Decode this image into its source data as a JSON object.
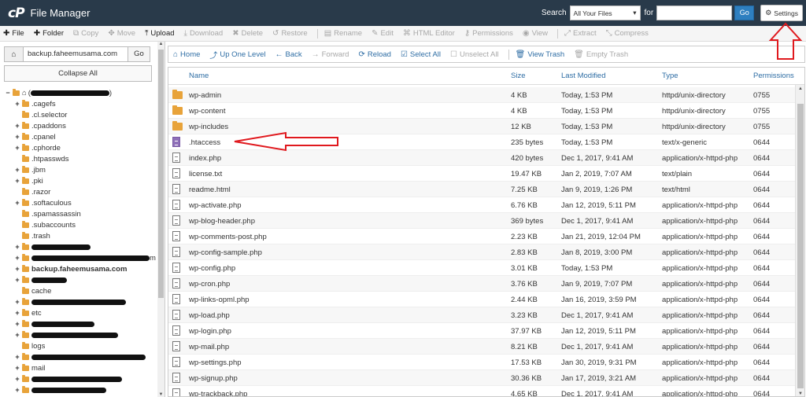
{
  "header": {
    "logo_mark": "cP",
    "title": "File Manager",
    "search_label": "Search",
    "search_scope": "All Your Files",
    "for_label": "for",
    "search_value": "",
    "go_label": "Go",
    "settings_label": "Settings"
  },
  "toolbar": {
    "items": [
      {
        "label": "File",
        "icon": "plus-icon",
        "enabled": true
      },
      {
        "label": "Folder",
        "icon": "plus-icon",
        "enabled": true
      },
      {
        "label": "Copy",
        "icon": "copy-icon",
        "enabled": false
      },
      {
        "label": "Move",
        "icon": "move-icon",
        "enabled": false
      },
      {
        "label": "Upload",
        "icon": "upload-icon",
        "enabled": true
      },
      {
        "label": "Download",
        "icon": "download-icon",
        "enabled": false
      },
      {
        "label": "Delete",
        "icon": "delete-icon",
        "enabled": false
      },
      {
        "label": "Restore",
        "icon": "restore-icon",
        "enabled": false
      },
      {
        "label": "Rename",
        "icon": "rename-icon",
        "enabled": false
      },
      {
        "label": "Edit",
        "icon": "pencil-icon",
        "enabled": false
      },
      {
        "label": "HTML Editor",
        "icon": "code-icon",
        "enabled": false
      },
      {
        "label": "Permissions",
        "icon": "key-icon",
        "enabled": false
      },
      {
        "label": "View",
        "icon": "eye-icon",
        "enabled": false
      },
      {
        "label": "Extract",
        "icon": "extract-icon",
        "enabled": false
      },
      {
        "label": "Compress",
        "icon": "compress-icon",
        "enabled": false
      }
    ]
  },
  "left": {
    "path_value": "backup.faheemusama.com",
    "go_label": "Go",
    "collapse_label": "Collapse All",
    "tree": [
      {
        "toggle": "−",
        "label": "(",
        "suffix": ")",
        "redact": 100,
        "home": true
      },
      {
        "toggle": "+",
        "label": ".cagefs"
      },
      {
        "toggle": "",
        "label": ".cl.selector"
      },
      {
        "toggle": "+",
        "label": ".cpaddons"
      },
      {
        "toggle": "+",
        "label": ".cpanel"
      },
      {
        "toggle": "+",
        "label": ".cphorde"
      },
      {
        "toggle": "",
        "label": ".htpasswds"
      },
      {
        "toggle": "+",
        "label": ".jbm"
      },
      {
        "toggle": "+",
        "label": ".pki"
      },
      {
        "toggle": "",
        "label": ".razor"
      },
      {
        "toggle": "+",
        "label": ".softaculous"
      },
      {
        "toggle": "",
        "label": ".spamassassin"
      },
      {
        "toggle": "",
        "label": ".subaccounts"
      },
      {
        "toggle": "",
        "label": ".trash"
      },
      {
        "toggle": "+",
        "label": "",
        "redact": 75
      },
      {
        "toggle": "+",
        "label": "",
        "redact": 150,
        "suffix": "m"
      },
      {
        "toggle": "+",
        "label": "backup.faheemusama.com",
        "bold": true
      },
      {
        "toggle": "+",
        "label": "",
        "redact": 45
      },
      {
        "toggle": "",
        "label": "cache"
      },
      {
        "toggle": "+",
        "label": "",
        "redact": 120
      },
      {
        "toggle": "+",
        "label": "etc"
      },
      {
        "toggle": "+",
        "label": "",
        "redact": 80
      },
      {
        "toggle": "+",
        "label": "",
        "redact": 110
      },
      {
        "toggle": "",
        "label": "logs"
      },
      {
        "toggle": "+",
        "label": "",
        "redact": 145
      },
      {
        "toggle": "+",
        "label": "mail"
      },
      {
        "toggle": "+",
        "label": "",
        "redact": 115
      },
      {
        "toggle": "+",
        "label": "",
        "redact": 95
      }
    ]
  },
  "nav": {
    "items": [
      {
        "label": "Home",
        "icon": "home-icon",
        "enabled": true
      },
      {
        "label": "Up One Level",
        "icon": "level-up-icon",
        "enabled": true
      },
      {
        "label": "Back",
        "icon": "arrow-left-icon",
        "enabled": true
      },
      {
        "label": "Forward",
        "icon": "arrow-right-icon",
        "enabled": false
      },
      {
        "label": "Reload",
        "icon": "reload-icon",
        "enabled": true
      },
      {
        "label": "Select All",
        "icon": "checkbox-checked-icon",
        "enabled": true
      },
      {
        "label": "Unselect All",
        "icon": "checkbox-empty-icon",
        "enabled": false
      },
      {
        "label": "View Trash",
        "icon": "trash-icon",
        "enabled": true
      },
      {
        "label": "Empty Trash",
        "icon": "trash-icon",
        "enabled": false
      }
    ]
  },
  "table": {
    "headers": {
      "name": "Name",
      "size": "Size",
      "modified": "Last Modified",
      "type": "Type",
      "perms": "Permissions"
    },
    "rows": [
      {
        "kind": "folder",
        "name": "wp-admin",
        "size": "4 KB",
        "modified": "Today, 1:53 PM",
        "type": "httpd/unix-directory",
        "perms": "0755"
      },
      {
        "kind": "folder",
        "name": "wp-content",
        "size": "4 KB",
        "modified": "Today, 1:53 PM",
        "type": "httpd/unix-directory",
        "perms": "0755"
      },
      {
        "kind": "folder",
        "name": "wp-includes",
        "size": "12 KB",
        "modified": "Today, 1:53 PM",
        "type": "httpd/unix-directory",
        "perms": "0755"
      },
      {
        "kind": "text",
        "name": ".htaccess",
        "size": "235 bytes",
        "modified": "Today, 1:53 PM",
        "type": "text/x-generic",
        "perms": "0644"
      },
      {
        "kind": "file",
        "name": "index.php",
        "size": "420 bytes",
        "modified": "Dec 1, 2017, 9:41 AM",
        "type": "application/x-httpd-php",
        "perms": "0644"
      },
      {
        "kind": "file",
        "name": "license.txt",
        "size": "19.47 KB",
        "modified": "Jan 2, 2019, 7:07 AM",
        "type": "text/plain",
        "perms": "0644"
      },
      {
        "kind": "file",
        "name": "readme.html",
        "size": "7.25 KB",
        "modified": "Jan 9, 2019, 1:26 PM",
        "type": "text/html",
        "perms": "0644"
      },
      {
        "kind": "file",
        "name": "wp-activate.php",
        "size": "6.76 KB",
        "modified": "Jan 12, 2019, 5:11 PM",
        "type": "application/x-httpd-php",
        "perms": "0644"
      },
      {
        "kind": "file",
        "name": "wp-blog-header.php",
        "size": "369 bytes",
        "modified": "Dec 1, 2017, 9:41 AM",
        "type": "application/x-httpd-php",
        "perms": "0644"
      },
      {
        "kind": "file",
        "name": "wp-comments-post.php",
        "size": "2.23 KB",
        "modified": "Jan 21, 2019, 12:04 PM",
        "type": "application/x-httpd-php",
        "perms": "0644"
      },
      {
        "kind": "file",
        "name": "wp-config-sample.php",
        "size": "2.83 KB",
        "modified": "Jan 8, 2019, 3:00 PM",
        "type": "application/x-httpd-php",
        "perms": "0644"
      },
      {
        "kind": "file",
        "name": "wp-config.php",
        "size": "3.01 KB",
        "modified": "Today, 1:53 PM",
        "type": "application/x-httpd-php",
        "perms": "0644"
      },
      {
        "kind": "file",
        "name": "wp-cron.php",
        "size": "3.76 KB",
        "modified": "Jan 9, 2019, 7:07 PM",
        "type": "application/x-httpd-php",
        "perms": "0644"
      },
      {
        "kind": "file",
        "name": "wp-links-opml.php",
        "size": "2.44 KB",
        "modified": "Jan 16, 2019, 3:59 PM",
        "type": "application/x-httpd-php",
        "perms": "0644"
      },
      {
        "kind": "file",
        "name": "wp-load.php",
        "size": "3.23 KB",
        "modified": "Dec 1, 2017, 9:41 AM",
        "type": "application/x-httpd-php",
        "perms": "0644"
      },
      {
        "kind": "file",
        "name": "wp-login.php",
        "size": "37.97 KB",
        "modified": "Jan 12, 2019, 5:11 PM",
        "type": "application/x-httpd-php",
        "perms": "0644"
      },
      {
        "kind": "file",
        "name": "wp-mail.php",
        "size": "8.21 KB",
        "modified": "Dec 1, 2017, 9:41 AM",
        "type": "application/x-httpd-php",
        "perms": "0644"
      },
      {
        "kind": "file",
        "name": "wp-settings.php",
        "size": "17.53 KB",
        "modified": "Jan 30, 2019, 9:31 PM",
        "type": "application/x-httpd-php",
        "perms": "0644"
      },
      {
        "kind": "file",
        "name": "wp-signup.php",
        "size": "30.36 KB",
        "modified": "Jan 17, 2019, 3:21 AM",
        "type": "application/x-httpd-php",
        "perms": "0644"
      },
      {
        "kind": "file",
        "name": "wp-trackback.php",
        "size": "4.65 KB",
        "modified": "Dec 1, 2017, 9:41 AM",
        "type": "application/x-httpd-php",
        "perms": "0644"
      }
    ]
  },
  "colors": {
    "header_bg": "#293a4a",
    "link": "#2e6da4",
    "folder": "#e8a33a",
    "annotation": "#e0191e"
  }
}
